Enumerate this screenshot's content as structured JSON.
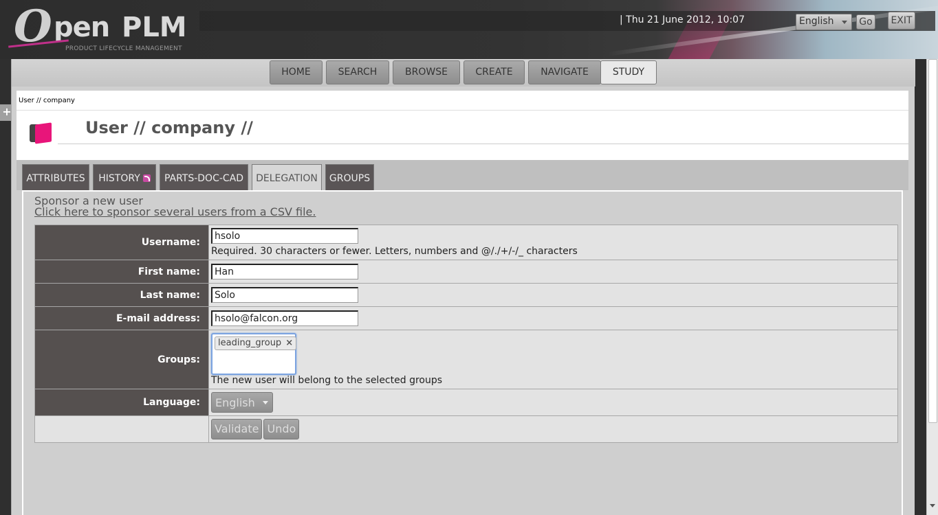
{
  "header": {
    "logo_o": "O",
    "logo_pen": "pen",
    "logo_plm": "PLM",
    "logo_tagline": "PRODUCT LIFECYCLE MANAGEMENT",
    "datetime": "| Thu 21 June 2012, 10:07",
    "language": "English",
    "go_label": "Go",
    "exit_label": "EXIT"
  },
  "nav": {
    "tabs": [
      {
        "label": "HOME"
      },
      {
        "label": "SEARCH"
      },
      {
        "label": "BROWSE"
      },
      {
        "label": "CREATE"
      },
      {
        "label": "NAVIGATE"
      },
      {
        "label": "STUDY",
        "active": true
      }
    ]
  },
  "side_toggle": "+",
  "page": {
    "breadcrumb": "User // company",
    "title": "User // company //"
  },
  "tabs": [
    {
      "label": "ATTRIBUTES"
    },
    {
      "label": "HISTORY"
    },
    {
      "label": "PARTS-DOC-CAD"
    },
    {
      "label": "DELEGATION",
      "active": true
    },
    {
      "label": "GROUPS"
    }
  ],
  "form": {
    "heading": "Sponsor a new user",
    "csv_link": "Click here to sponsor several users from a CSV file.",
    "username": {
      "label": "Username:",
      "value": "hsolo",
      "help": "Required. 30 characters or fewer. Letters, numbers and @/./+/-/_ characters"
    },
    "first_name": {
      "label": "First name:",
      "value": "Han"
    },
    "last_name": {
      "label": "Last name:",
      "value": "Solo"
    },
    "email": {
      "label": "E-mail address:",
      "value": "hsolo@falcon.org"
    },
    "groups": {
      "label": "Groups:",
      "selected": "leading_group",
      "remove": "×",
      "help": "The new user will belong to the selected groups"
    },
    "language": {
      "label": "Language:",
      "value": "English"
    },
    "validate_label": "Validate",
    "undo_label": "Undo"
  },
  "colors": {
    "label_bg": "#55504f",
    "accent_pink": "#e8157a",
    "focus_blue": "#7ba3e0"
  }
}
